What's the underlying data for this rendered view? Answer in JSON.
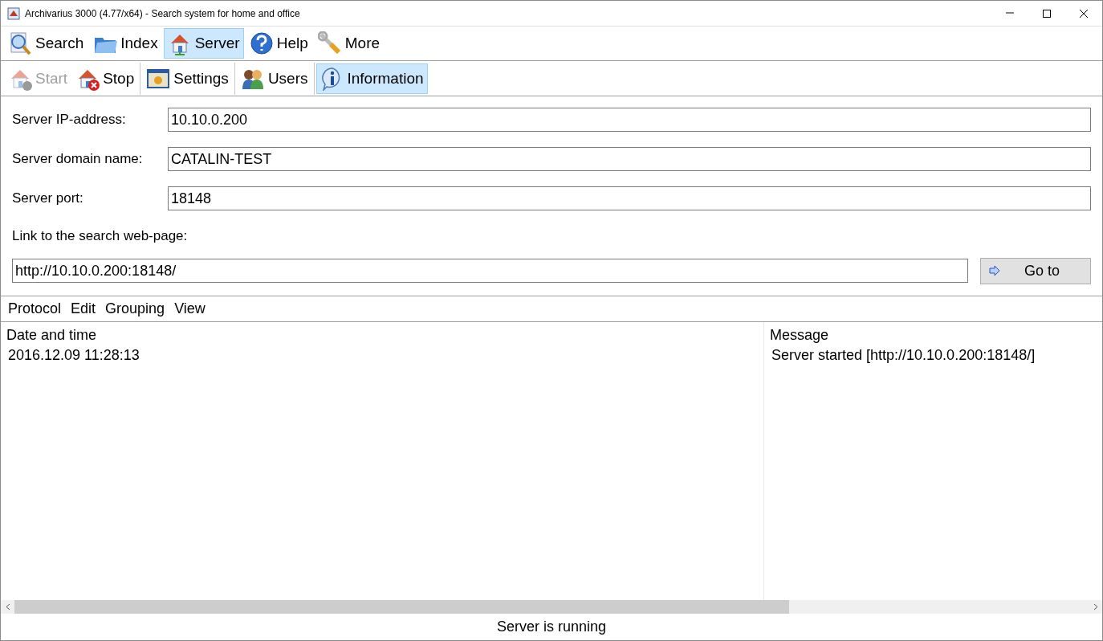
{
  "window": {
    "title": "Archivarius 3000 (4.77/x64) - Search system for home and office"
  },
  "main_toolbar": [
    {
      "label": "Search",
      "selected": false
    },
    {
      "label": "Index",
      "selected": false
    },
    {
      "label": "Server",
      "selected": true
    },
    {
      "label": "Help",
      "selected": false
    },
    {
      "label": "More",
      "selected": false
    }
  ],
  "server_toolbar": [
    {
      "label": "Start",
      "selected": false,
      "disabled": true
    },
    {
      "label": "Stop",
      "selected": false,
      "disabled": false
    },
    {
      "label": "Settings",
      "selected": false,
      "disabled": false
    },
    {
      "label": "Users",
      "selected": false,
      "disabled": false
    },
    {
      "label": "Information",
      "selected": true,
      "disabled": false
    }
  ],
  "fields": [
    {
      "label": "Server IP-address:",
      "value": "10.10.0.200"
    },
    {
      "label": "Server domain name:",
      "value": "CATALIN-TEST"
    },
    {
      "label": "Server port:",
      "value": "18148"
    }
  ],
  "link": {
    "label": "Link to the search web-page:",
    "value": "http://10.10.0.200:18148/",
    "button": "Go to"
  },
  "protocol_menu": [
    "Protocol",
    "Edit",
    "Grouping",
    "View"
  ],
  "table": {
    "columns": [
      "Date and time",
      "Message"
    ],
    "rows": [
      [
        "2016.12.09 11:28:13",
        "Server started [http://10.10.0.200:18148/]"
      ]
    ]
  },
  "status_bar": "Server is running"
}
